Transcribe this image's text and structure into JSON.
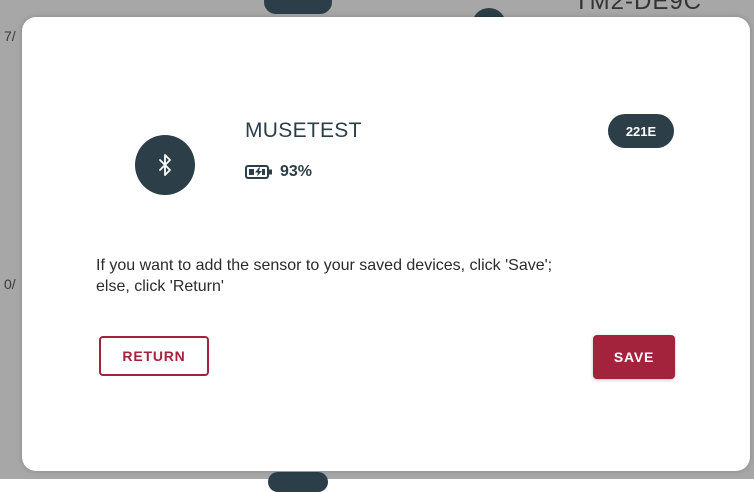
{
  "background": {
    "left_fragment_1": "7/",
    "left_fragment_2": "0/",
    "top_right_fragment": "TM2-DE9C"
  },
  "dialog": {
    "device_name": "MUSETEST",
    "battery": "93%",
    "device_id": "221E",
    "message_line_1": "If you want to add the sensor to your saved devices, click 'Save';",
    "message_line_2": "else, click 'Return'",
    "return_label": "RETURN",
    "save_label": "SAVE"
  },
  "icons": {
    "device": "bluetooth-icon",
    "battery": "battery-charging-icon"
  },
  "colors": {
    "primary_dark": "#2c3e48",
    "accent": "#a3233c",
    "backdrop": "#a7a7a7"
  }
}
